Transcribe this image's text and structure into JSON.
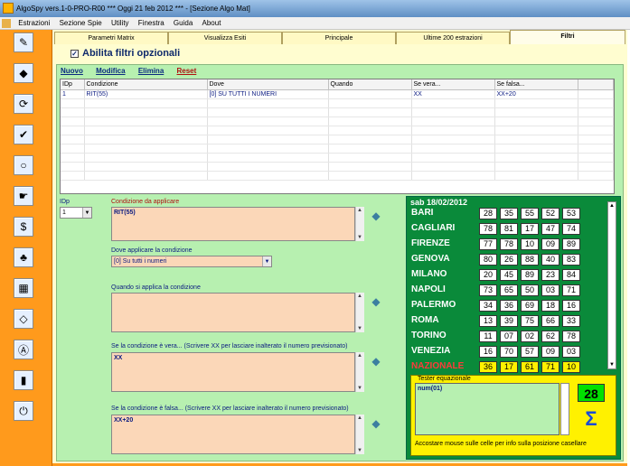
{
  "window": {
    "title": "AlgoSpy vers.1-0-PRO-R00  ***  Oggi 21 feb 2012  ***  - [Sezione Algo Mat]"
  },
  "menu": [
    "Estrazioni",
    "Sezione Spie",
    "Utility",
    "Finestra",
    "Guida",
    "About"
  ],
  "sidebar_icons": [
    "pencil-icon",
    "diamond-icon",
    "refresh-icon",
    "chart-check-icon",
    "bulb-icon",
    "pointer-icon",
    "money-icon",
    "tree-icon",
    "grid-icon",
    "drop-icon",
    "a-icon",
    "book-icon",
    "power-icon"
  ],
  "tabs": [
    "Parametri Matrix",
    "Visualizza Esiti",
    "Principale",
    "Ultime 200 estrazioni",
    "Filtri"
  ],
  "abilita": {
    "label": "Abilita filtri opzionali",
    "check": "✓"
  },
  "links": {
    "nuovo": "Nuovo",
    "modifica": "Modifica",
    "elimina": "Elimina",
    "reset": "Reset"
  },
  "grid": {
    "headers": [
      "IDp",
      "Condizione",
      "Dove",
      "Quando",
      "Se vera...",
      "Se falsa..."
    ],
    "rows": [
      [
        "1",
        "RIT(55)",
        "[0] SU TUTTI I NUMERI",
        "",
        "XX",
        "XX+20"
      ]
    ]
  },
  "form": {
    "idp_label": "IDp",
    "idp_value": "1",
    "cond_label": "Condizione da applicare",
    "cond_value": "RIT(55)",
    "dove_label": "Dove applicare la condizione",
    "dove_value": "[0] Su tutti i numeri",
    "quando_label": "Quando si applica la condizione",
    "quando_value": "",
    "vera_label": "Se la condizione è vera... (Scrivere XX per lasciare inalterato il numero previsionato)",
    "vera_value": "XX",
    "falsa_label": "Se la condizione è falsa...  (Scrivere XX per lasciare inalterato il numero previsionato)",
    "falsa_value": "XX+20"
  },
  "estrazioni": {
    "date": "sab 18/02/2012",
    "ruote": [
      {
        "name": "BARI",
        "nums": [
          "28",
          "35",
          "55",
          "52",
          "53"
        ]
      },
      {
        "name": "CAGLIARI",
        "nums": [
          "78",
          "81",
          "17",
          "47",
          "74"
        ]
      },
      {
        "name": "FIRENZE",
        "nums": [
          "77",
          "78",
          "10",
          "09",
          "89"
        ]
      },
      {
        "name": "GENOVA",
        "nums": [
          "80",
          "26",
          "88",
          "40",
          "83"
        ]
      },
      {
        "name": "MILANO",
        "nums": [
          "20",
          "45",
          "89",
          "23",
          "84"
        ]
      },
      {
        "name": "NAPOLI",
        "nums": [
          "73",
          "65",
          "50",
          "03",
          "71"
        ]
      },
      {
        "name": "PALERMO",
        "nums": [
          "34",
          "36",
          "69",
          "18",
          "16"
        ]
      },
      {
        "name": "ROMA",
        "nums": [
          "13",
          "39",
          "75",
          "66",
          "33"
        ]
      },
      {
        "name": "TORINO",
        "nums": [
          "11",
          "07",
          "02",
          "62",
          "78"
        ]
      },
      {
        "name": "VENEZIA",
        "nums": [
          "16",
          "70",
          "57",
          "09",
          "03"
        ]
      },
      {
        "name": "NAZIONALE",
        "nums": [
          "36",
          "17",
          "61",
          "71",
          "10"
        ]
      }
    ]
  },
  "tester": {
    "label": "Tester equazionale",
    "value": "num(01)",
    "result": "28",
    "sigma": "Σ",
    "hint": "Accostare mouse sulle celle per info sulla posizione casellare"
  }
}
